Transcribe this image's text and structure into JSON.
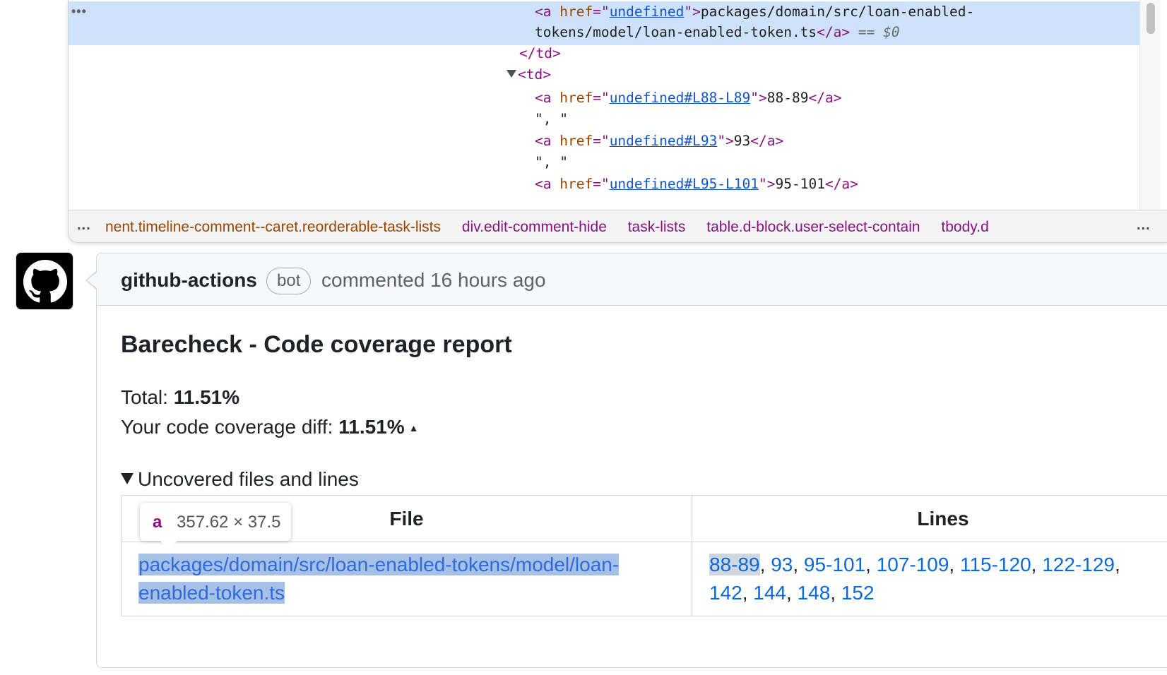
{
  "devtools": {
    "row_dots": "•••",
    "lines": {
      "l1_href": "undefined",
      "l1_text": "packages/domain/src/loan-enabled-",
      "l2_text": "tokens/model/loan-enabled-token.ts",
      "eq": "== $0",
      "td_close": "</td>",
      "td_open": "<td>",
      "a1_href": "undefined#L88-L89",
      "a1_text": "88-89",
      "sep1": "\", \"",
      "a2_href": "undefined#L93",
      "a2_text": "93",
      "sep2": "\", \"",
      "a3_href": "undefined#L95-L101",
      "a3_text": "95-101"
    },
    "breadcrumbs": {
      "left_dots": "...",
      "right_dots": "...",
      "items": [
        "nent.timeline-comment--caret.reorderable-task-lists",
        "div.edit-comment-hide",
        "task-lists",
        "table.d-block.user-select-contain",
        "tbody.d"
      ]
    }
  },
  "comment": {
    "author": "github-actions",
    "badge": "bot",
    "meta": "commented 16 hours ago",
    "title": "Barecheck - Code coverage report",
    "total_label": "Total:",
    "total_value": "11.51%",
    "diff_label": "Your code coverage diff:",
    "diff_value": "11.51%",
    "diff_arrow": "▲",
    "summary": "Uncovered files and lines",
    "table": {
      "headers": [
        "File",
        "Lines"
      ],
      "file_line1": "packages/domain/src/loan-enabled-tokens/model/loan-",
      "file_line2": "enabled-token.ts",
      "lines": [
        "88-89",
        "93",
        "95-101",
        "107-109",
        "115-120",
        "122-129",
        "142",
        "144",
        "148",
        "152"
      ]
    }
  },
  "tooltip": {
    "tag": "a",
    "dims": "357.62 × 37.5"
  }
}
